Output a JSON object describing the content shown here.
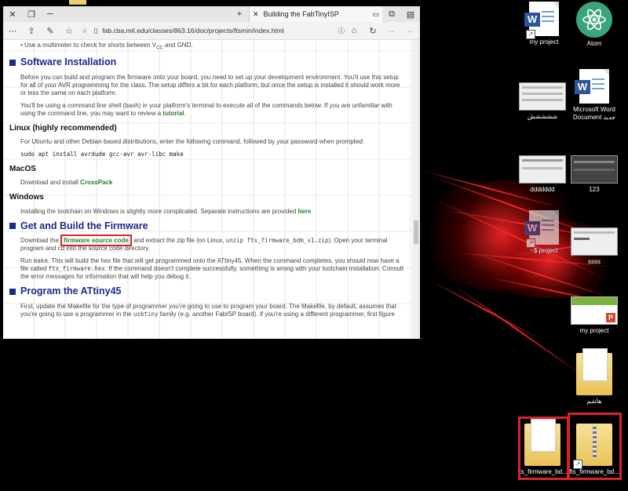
{
  "browser": {
    "tab_title": "Building the FabTinyISP",
    "url": "fab.cba.mit.edu/classes/863.16/doc/projects/ftsmin/index.html"
  },
  "page": {
    "top_bullet": "Use a multimeter to check for shorts between V",
    "top_bullet_sub": "CC",
    "top_bullet_end": " and GND.",
    "sections": {
      "software_installation": {
        "heading": "Software Installation",
        "p1": "Before you can build and program the firmware onto your board, you need to set up your development environment. You'll use this setup for all of your AVR programming for the class. The setup differs a bit for each platform, but once the setup is installed it should work more or less the same on each platform.",
        "p2_start": "You'll be using a command line shell (bash) in your platform's terminal to execute all of the commands below. If you are unfamiliar with using the command line, you may want to review a ",
        "p2_link": "tutorial",
        "p2_end": "."
      },
      "linux": {
        "heading": "Linux (highly recommended)",
        "p1": "For Ubuntu and other Debian-based distributions, enter the following command, followed by your password when prompted:",
        "code": "sudo apt install avrdude gcc-avr avr-libc make"
      },
      "macos": {
        "heading": "MacOS",
        "p_start": "Download and install ",
        "link": "CrossPack"
      },
      "windows": {
        "heading": "Windows",
        "p_start": "Installing the toolchain on Windows is slightly more complicated. Separate instructions are provided ",
        "link": "here"
      },
      "get_build": {
        "heading": "Get and Build the Firmware",
        "p1_start": "Download the ",
        "p1_link": "firmware source code",
        "p1_mid": " and extract the zip file (on Linux, ",
        "p1_code": "unzip fts_firmware_bdm_v1.zip",
        "p1_end": "). Open your terminal program and cd into the source code directory.",
        "p2_start": "Run ",
        "p2_code1": "make",
        "p2_mid": ". This will build the hex file that will get programmed onto the ATtiny45. When the command completes, you should now have a file called ",
        "p2_code2": "fts_firmware.hex",
        "p2_end": ". If the command doesn't complete successfully, something is wrong with your toolchain installation. Consult the error messages for information that will help you debug it."
      },
      "program": {
        "heading": "Program the ATtiny45",
        "p1_start": "First, update the Makefile for the type of programmer you're going to use to program your board. The Makefile, by default, assumes that you're going to use a programmer in the ",
        "p1_code": "usbtiny",
        "p1_end": " family (e.g. another FabISP board). If you're using a different programmer, first figure"
      }
    }
  },
  "desktop": {
    "icons": [
      {
        "label": "my project",
        "type": "word"
      },
      {
        "label": "Atom",
        "type": "atom"
      },
      {
        "label": "ششششش",
        "type": "screenshot"
      },
      {
        "label": "Microsoft Word Document جديد",
        "type": "word"
      },
      {
        "label": "ddddddd",
        "type": "screenshot"
      },
      {
        "label": "123",
        "type": "screenshot"
      },
      {
        "label": "~$ project",
        "type": "word"
      },
      {
        "label": "ssss",
        "type": "screenshot"
      },
      {
        "label": "my project",
        "type": "ppt"
      },
      {
        "label": "هاشم",
        "type": "folder"
      },
      {
        "label": "fts_firmware_bd...",
        "type": "folder"
      },
      {
        "label": "fts_firmware_bd...",
        "type": "zip"
      }
    ]
  }
}
